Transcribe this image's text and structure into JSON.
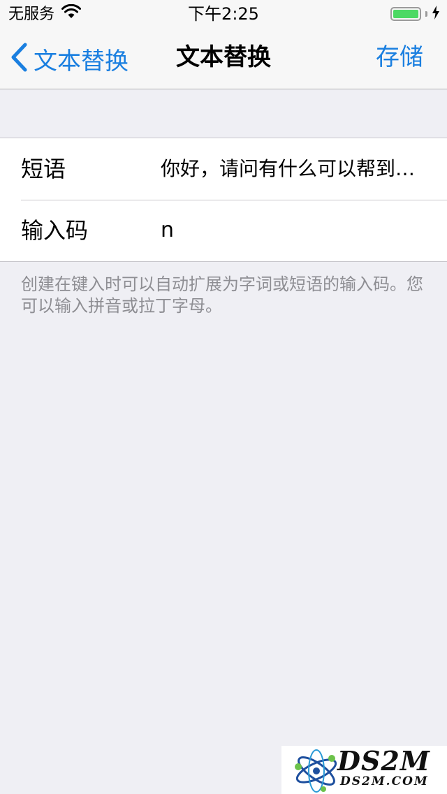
{
  "status_bar": {
    "carrier": "无服务",
    "time": "下午2:25",
    "wifi_icon": "wifi-icon",
    "battery_icon": "battery-icon",
    "charging_icon": "charging-bolt-icon",
    "battery_level": 0.9,
    "battery_color": "#4cd964"
  },
  "nav": {
    "back_label": "文本替换",
    "back_icon": "chevron-left-icon",
    "title": "文本替换",
    "save_label": "存储",
    "accent_color": "#1a7fe0"
  },
  "form": {
    "phrase": {
      "label": "短语",
      "value": "你好，请问有什么可以帮到…"
    },
    "shortcut": {
      "label": "输入码",
      "value": "n"
    }
  },
  "footer_note": "创建在键入时可以自动扩展为字词或短语的输入码。您可以输入拼音或拉丁字母。",
  "watermark": {
    "logo_text": "DS2M",
    "logo_subtext": "DS2M.COM"
  }
}
